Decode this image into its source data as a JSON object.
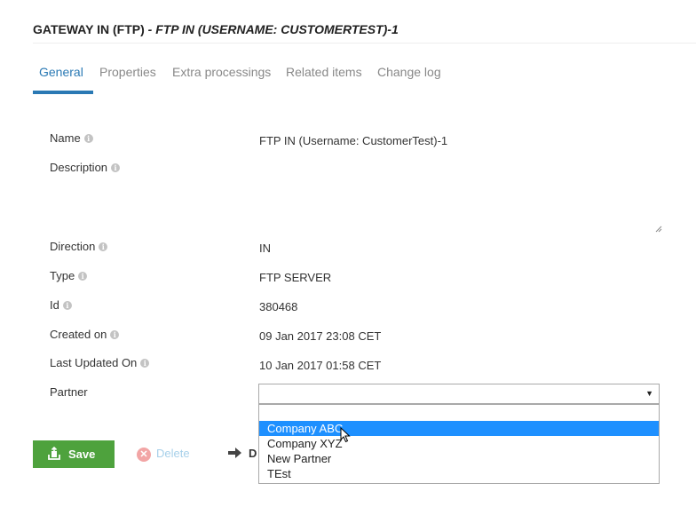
{
  "header": {
    "title": "GATEWAY IN (FTP)",
    "separator": " - ",
    "subtitle": "FTP IN (USERNAME: CUSTOMERTEST)-1"
  },
  "tabs": [
    {
      "label": "General",
      "active": true
    },
    {
      "label": "Properties"
    },
    {
      "label": "Extra processings"
    },
    {
      "label": "Related items"
    },
    {
      "label": "Change log"
    }
  ],
  "fields": {
    "name": {
      "label": "Name",
      "value": "FTP IN (Username: CustomerTest)-1"
    },
    "description": {
      "label": "Description",
      "value": ""
    },
    "direction": {
      "label": "Direction",
      "value": "IN"
    },
    "type": {
      "label": "Type",
      "value": "FTP SERVER"
    },
    "id": {
      "label": "Id",
      "value": "380468"
    },
    "created_on": {
      "label": "Created on",
      "value": "09 Jan 2017 23:08 CET"
    },
    "last_updated_on": {
      "label": "Last Updated On",
      "value": "10 Jan 2017 01:58 CET"
    },
    "partner": {
      "label": "Partner",
      "value": "",
      "options": [
        "Company ABC",
        "Company XYZ",
        "New Partner",
        "TEst"
      ],
      "highlighted": "Company ABC"
    }
  },
  "actions": {
    "save": "Save",
    "delete": "Delete",
    "more": "D"
  },
  "colors": {
    "accent": "#2a79b4",
    "save": "#4ea23d",
    "option_highlight": "#1e90ff"
  }
}
